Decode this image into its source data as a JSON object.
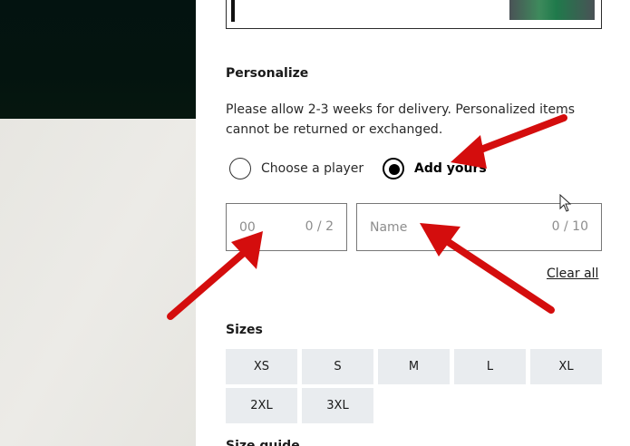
{
  "personalize": {
    "title": "Personalize",
    "notice": "Please allow 2-3 weeks for delivery. Personalized items cannot be returned or exchanged.",
    "options": [
      {
        "label": "Choose a player",
        "selected": false
      },
      {
        "label": "Add yours",
        "selected": true
      }
    ],
    "number_field": {
      "placeholder": "00",
      "counter": "0 / 2"
    },
    "name_field": {
      "placeholder": "Name",
      "counter": "0 / 10"
    },
    "clear_all": "Clear all"
  },
  "sizes": {
    "title": "Sizes",
    "options": [
      "XS",
      "S",
      "M",
      "L",
      "XL",
      "2XL",
      "3XL"
    ]
  },
  "size_guide": "Size guide",
  "colors": {
    "annotation_arrow": "#d40d0d",
    "size_button_bg": "#e9ecef"
  }
}
